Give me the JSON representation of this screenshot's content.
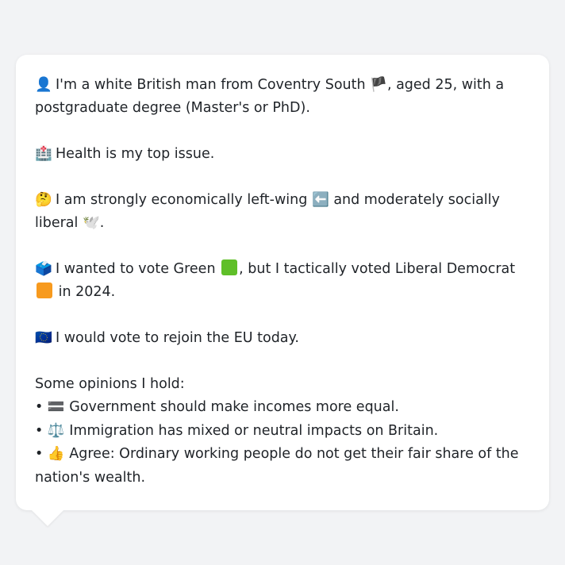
{
  "profile": {
    "intro_icon": "person-silhouette-icon",
    "intro_text": "I'm a white British man from Coventry South",
    "flag_icon": "england-flag-icon",
    "intro_text_2": ", aged 25, with a postgraduate degree (Master's or PhD).",
    "health_icon": "hospital-icon",
    "health_text": "Health is my top issue.",
    "thinking_icon": "thinking-face-icon",
    "economic_text": "I am strongly economically left-wing",
    "left_arrow_icon": "left-arrow-icon",
    "social_text": "and moderately socially liberal",
    "dove_icon": "dove-icon",
    "ballot_icon": "ballot-box-icon",
    "vote_text_1": "I wanted to vote Green",
    "green_square_icon": "green-square-icon",
    "vote_text_2": ", but I tactically voted Liberal Democrat",
    "orange_square_icon": "orange-square-icon",
    "vote_text_3": "in 2024.",
    "eu_icon": "eu-flag-icon",
    "eu_text": "I would vote to rejoin the EU today.",
    "opinions_heading": "Some opinions I hold:",
    "opinions": [
      {
        "bullet": "•",
        "icon": "equals-sign-icon",
        "text": "Government should make incomes more equal."
      },
      {
        "bullet": "•",
        "icon": "balance-scale-icon",
        "text": "Immigration has mixed or neutral impacts on Britain."
      },
      {
        "bullet": "•",
        "icon": "thumbs-up-icon",
        "text": "Agree: Ordinary working people do not get their fair share of the nation's wealth."
      }
    ]
  },
  "colors": {
    "background": "#f2f3f5",
    "bubble": "#ffffff",
    "text": "#1f2328",
    "green": "#5fbf28",
    "orange": "#f79a1e"
  }
}
